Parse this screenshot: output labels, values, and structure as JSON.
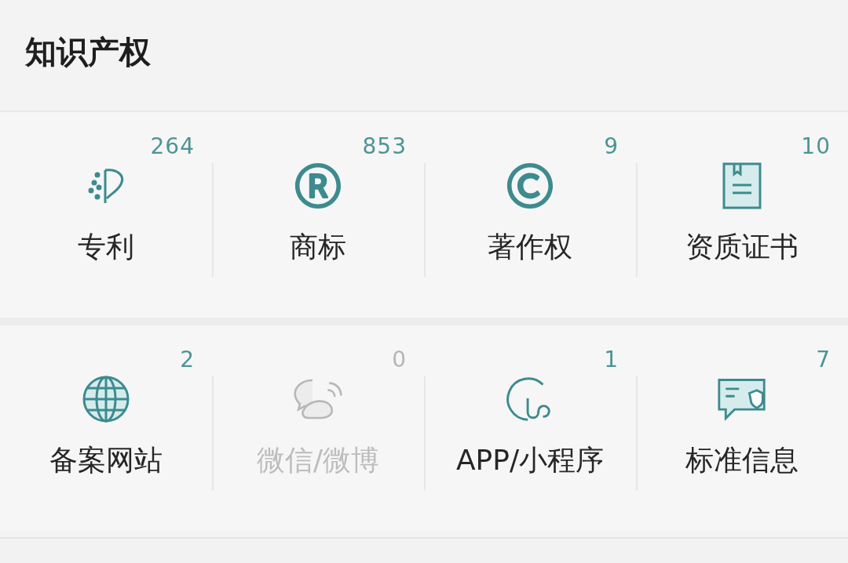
{
  "header": {
    "title": "知识产权"
  },
  "rows": [
    {
      "items": [
        {
          "label": "专利",
          "count": "264",
          "disabled": false
        },
        {
          "label": "商标",
          "count": "853",
          "disabled": false
        },
        {
          "label": "著作权",
          "count": "9",
          "disabled": false
        },
        {
          "label": "资质证书",
          "count": "10",
          "disabled": false
        }
      ]
    },
    {
      "items": [
        {
          "label": "备案网站",
          "count": "2",
          "disabled": false
        },
        {
          "label": "微信/微博",
          "count": "0",
          "disabled": true
        },
        {
          "label": "APP/小程序",
          "count": "1",
          "disabled": false
        },
        {
          "label": "标准信息",
          "count": "7",
          "disabled": false
        }
      ]
    }
  ]
}
